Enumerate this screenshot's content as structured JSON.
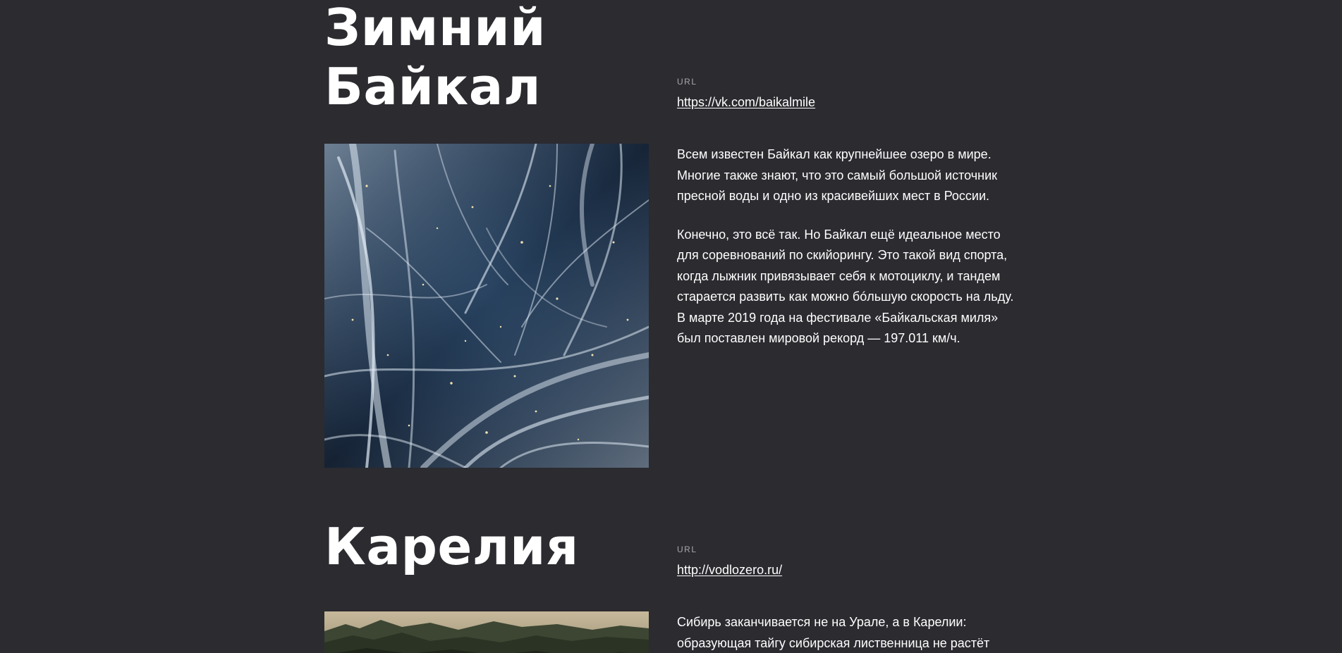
{
  "sections": [
    {
      "title": "Зимний Байкал",
      "url_label": "URL",
      "url": "https://vk.com/baikalmile",
      "image_alt": "ice",
      "paragraphs": [
        "Всем известен Байкал как крупнейшее озеро в мире. Многие также знают, что это самый большой источник пресной воды и одно из красивейших мест в России.",
        "Конечно, это всё так. Но Байкал ещё идеальное место для соревнований по скийорингу. Это такой вид спорта, когда лыжник привязывает себя к мотоциклу, и тандем старается развить как можно бóльшую скорость на льду. В марте 2019 года на фестивале «Байкальская миля» был поставлен мировой рекорд — 197.011 км/ч."
      ]
    },
    {
      "title": "Карелия",
      "url_label": "URL",
      "url": "http://vodlozero.ru/",
      "image_alt": "forest",
      "paragraphs": [
        "Сибирь заканчивается не на Урале, а в Карелии: образующая тайгу сибирская лиственница не растёт"
      ]
    }
  ],
  "colors": {
    "background": "#2b2b30",
    "text": "#ffffff",
    "label": "#a7a7ac"
  }
}
